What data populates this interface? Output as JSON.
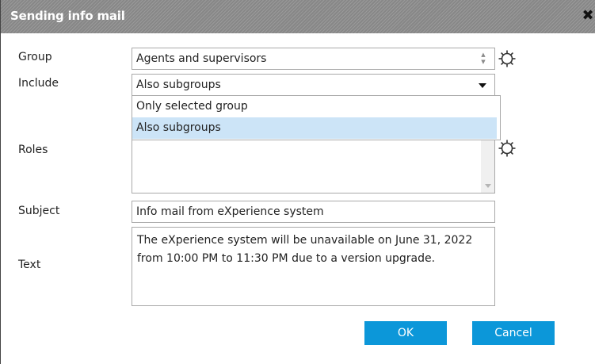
{
  "window": {
    "title": "Sending info mail"
  },
  "colors": {
    "accent": "#0c97d9",
    "selected_option": "#cce4f7",
    "titlebar": "#8f8f8f"
  },
  "form": {
    "group": {
      "label": "Group",
      "value": "Agents and supervisors",
      "settings_icon": "gear-icon"
    },
    "include": {
      "label": "Include",
      "value": "Also subgroups",
      "options": [
        "Only selected group",
        "Also subgroups"
      ],
      "selected_index": 1
    },
    "roles": {
      "label": "Roles",
      "settings_icon": "gear-icon"
    },
    "subject": {
      "label": "Subject",
      "value": "Info mail from eXperience system"
    },
    "text": {
      "label": "Text",
      "value": "The eXperience system will be unavailable on June 31, 2022 from 10:00 PM to 11:30 PM due to a version upgrade."
    }
  },
  "buttons": {
    "ok": "OK",
    "cancel": "Cancel"
  }
}
